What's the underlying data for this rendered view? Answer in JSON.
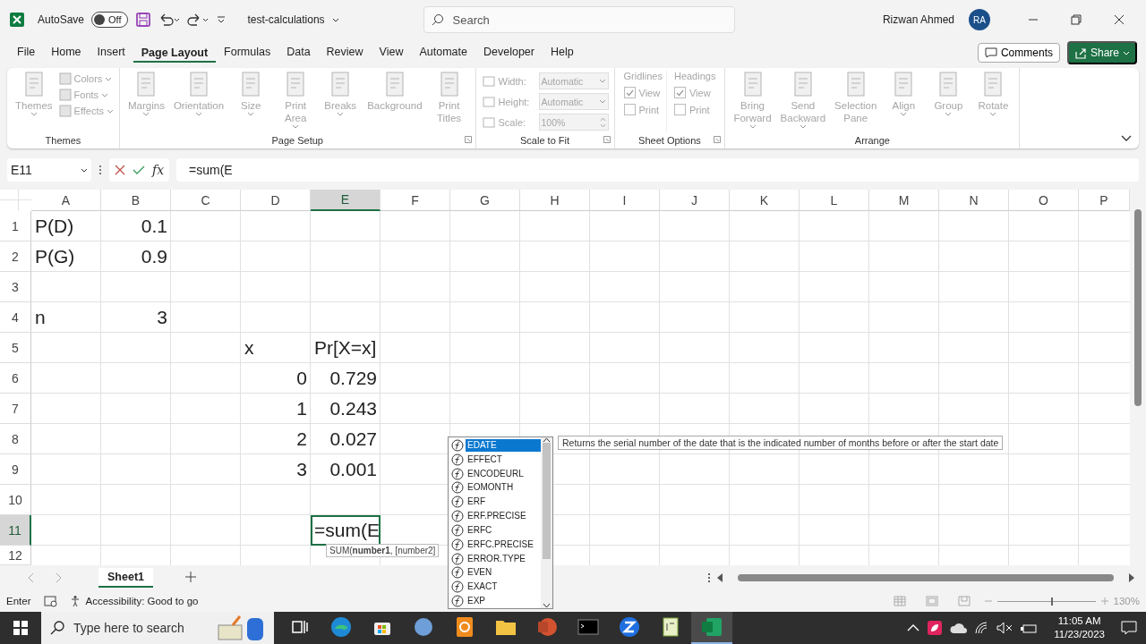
{
  "title_bar": {
    "autosave_label": "AutoSave",
    "autosave": {
      "on": false,
      "label": "Off"
    },
    "file_name": "test-calculations",
    "search": {
      "placeholder": "Search"
    },
    "user_name": "Rizwan Ahmed",
    "user_initials": "RA"
  },
  "menu": [
    {
      "label": "File",
      "selected": false
    },
    {
      "label": "Home",
      "selected": false
    },
    {
      "label": "Insert",
      "selected": false
    },
    {
      "label": "Page Layout",
      "selected": true
    },
    {
      "label": "Formulas",
      "selected": false
    },
    {
      "label": "Data",
      "selected": false
    },
    {
      "label": "Review",
      "selected": false
    },
    {
      "label": "View",
      "selected": false
    },
    {
      "label": "Automate",
      "selected": false
    },
    {
      "label": "Developer",
      "selected": false
    },
    {
      "label": "Help",
      "selected": false
    }
  ],
  "actions": {
    "comments": "Comments",
    "share": "Share"
  },
  "ribbon": {
    "disabled": true,
    "groups": [
      {
        "label": "Themes",
        "launcher": false,
        "items": [
          {
            "kind": "large",
            "label": "Themes",
            "dropdown": true
          },
          {
            "kind": "stack",
            "items": [
              {
                "label": "Colors",
                "dropdown": true
              },
              {
                "label": "Fonts",
                "dropdown": true
              },
              {
                "label": "Effects",
                "dropdown": true
              }
            ]
          }
        ]
      },
      {
        "label": "Page Setup",
        "launcher": true,
        "items": [
          {
            "kind": "large",
            "label": "Margins",
            "dropdown": true
          },
          {
            "kind": "large",
            "label": "Orientation",
            "dropdown": true
          },
          {
            "kind": "large",
            "label": "Size",
            "dropdown": true
          },
          {
            "kind": "large",
            "label": "Print Area",
            "dropdown": true
          },
          {
            "kind": "large",
            "label": "Breaks",
            "dropdown": true
          },
          {
            "kind": "large",
            "label": "Background",
            "dropdown": false
          },
          {
            "kind": "large",
            "label": "Print Titles",
            "dropdown": false
          }
        ]
      },
      {
        "label": "Scale to Fit",
        "launcher": true,
        "items": [
          {
            "kind": "fields",
            "items": [
              {
                "label": "Width:",
                "value": "Automatic",
                "spinner": false
              },
              {
                "label": "Height:",
                "value": "Automatic",
                "spinner": false
              },
              {
                "label": "Scale:",
                "value": "100%",
                "spinner": true
              }
            ]
          }
        ]
      },
      {
        "label": "Sheet Options",
        "launcher": true,
        "items": [
          {
            "kind": "options",
            "title": "Gridlines",
            "checks": [
              {
                "label": "View",
                "checked": true
              },
              {
                "label": "Print",
                "checked": false
              }
            ]
          },
          {
            "kind": "options",
            "title": "Headings",
            "checks": [
              {
                "label": "View",
                "checked": true
              },
              {
                "label": "Print",
                "checked": false
              }
            ]
          }
        ]
      },
      {
        "label": "Arrange",
        "launcher": false,
        "items": [
          {
            "kind": "large",
            "label": "Bring Forward",
            "dropdown": true
          },
          {
            "kind": "large",
            "label": "Send Backward",
            "dropdown": true
          },
          {
            "kind": "large",
            "label": "Selection Pane",
            "dropdown": false
          },
          {
            "kind": "large",
            "label": "Align",
            "dropdown": true
          },
          {
            "kind": "large",
            "label": "Group",
            "dropdown": true
          },
          {
            "kind": "large",
            "label": "Rotate",
            "dropdown": true
          }
        ]
      }
    ]
  },
  "formula_bar": {
    "name_box": "E11",
    "insert_function": "fx",
    "formula": "=sum(E"
  },
  "sheet": {
    "columns": [
      {
        "label": "A",
        "selected": false
      },
      {
        "label": "B",
        "selected": false
      },
      {
        "label": "C",
        "selected": false
      },
      {
        "label": "D",
        "selected": false
      },
      {
        "label": "E",
        "selected": true
      },
      {
        "label": "F",
        "selected": false
      },
      {
        "label": "G",
        "selected": false
      },
      {
        "label": "H",
        "selected": false
      },
      {
        "label": "I",
        "selected": false
      },
      {
        "label": "J",
        "selected": false
      },
      {
        "label": "K",
        "selected": false
      },
      {
        "label": "L",
        "selected": false
      },
      {
        "label": "M",
        "selected": false
      },
      {
        "label": "N",
        "selected": false
      },
      {
        "label": "O",
        "selected": false
      },
      {
        "label": "P",
        "selected": false
      }
    ],
    "rows": [
      {
        "label": "1",
        "selected": false,
        "cells": {
          "A": {
            "value": "P(D)",
            "kind": "text"
          },
          "B": {
            "value": "0.1",
            "kind": "number"
          }
        }
      },
      {
        "label": "2",
        "selected": false,
        "cells": {
          "A": {
            "value": "P(G)",
            "kind": "text"
          },
          "B": {
            "value": "0.9",
            "kind": "number"
          }
        }
      },
      {
        "label": "3",
        "selected": false
      },
      {
        "label": "4",
        "selected": false,
        "cells": {
          "A": {
            "value": "n",
            "kind": "text"
          },
          "B": {
            "value": "3",
            "kind": "number"
          }
        }
      },
      {
        "label": "5",
        "selected": false,
        "cells": {
          "D": {
            "value": "x",
            "kind": "text"
          },
          "E": {
            "value": "Pr[X=x]",
            "kind": "text"
          }
        }
      },
      {
        "label": "6",
        "selected": false,
        "cells": {
          "D": {
            "value": "0",
            "kind": "number"
          },
          "E": {
            "value": "0.729",
            "kind": "number"
          }
        }
      },
      {
        "label": "7",
        "selected": false,
        "cells": {
          "D": {
            "value": "1",
            "kind": "number"
          },
          "E": {
            "value": "0.243",
            "kind": "number"
          }
        }
      },
      {
        "label": "8",
        "selected": false,
        "cells": {
          "D": {
            "value": "2",
            "kind": "number"
          },
          "E": {
            "value": "0.027",
            "kind": "number"
          }
        }
      },
      {
        "label": "9",
        "selected": false,
        "cells": {
          "D": {
            "value": "3",
            "kind": "number"
          },
          "E": {
            "value": "0.001",
            "kind": "number"
          }
        }
      },
      {
        "label": "10",
        "selected": false
      },
      {
        "label": "11",
        "selected": true,
        "cells": {
          "E": {
            "value": "=sum(E",
            "kind": "editing"
          }
        }
      },
      {
        "label": "12",
        "selected": false
      }
    ]
  },
  "autocomplete": {
    "items": [
      {
        "label": "EDATE",
        "selected": true
      },
      {
        "label": "EFFECT",
        "selected": false
      },
      {
        "label": "ENCODEURL",
        "selected": false
      },
      {
        "label": "EOMONTH",
        "selected": false
      },
      {
        "label": "ERF",
        "selected": false
      },
      {
        "label": "ERF.PRECISE",
        "selected": false
      },
      {
        "label": "ERFC",
        "selected": false
      },
      {
        "label": "ERFC.PRECISE",
        "selected": false
      },
      {
        "label": "ERROR.TYPE",
        "selected": false
      },
      {
        "label": "EVEN",
        "selected": false
      },
      {
        "label": "EXACT",
        "selected": false
      },
      {
        "label": "EXP",
        "selected": false
      }
    ],
    "description": "Returns the serial number of the date that is the indicated number of months before or after the start date",
    "hint": "SUM(**number1**, [number2]"
  },
  "sheet_tabs": [
    {
      "label": "Sheet1",
      "selected": true
    }
  ],
  "status_bar": {
    "mode": "Enter",
    "accessibility": "Accessibility: Good to go",
    "zoom": {
      "label": "130%",
      "level": 0.55
    }
  },
  "taskbar": {
    "search_placeholder": "Type here to search",
    "apps": [
      {
        "kind": "taskview",
        "selected": false
      },
      {
        "kind": "edge",
        "selected": false
      },
      {
        "kind": "store",
        "selected": false
      },
      {
        "kind": "r",
        "selected": false
      },
      {
        "kind": "gapp",
        "selected": false
      },
      {
        "kind": "folder",
        "selected": false
      },
      {
        "kind": "powerpoint",
        "selected": false
      },
      {
        "kind": "terminal",
        "selected": false
      },
      {
        "kind": "z",
        "selected": false
      },
      {
        "kind": "notepad",
        "selected": false
      },
      {
        "kind": "excel",
        "selected": true
      }
    ],
    "time": "11:05 AM",
    "date": "11/23/2023"
  }
}
